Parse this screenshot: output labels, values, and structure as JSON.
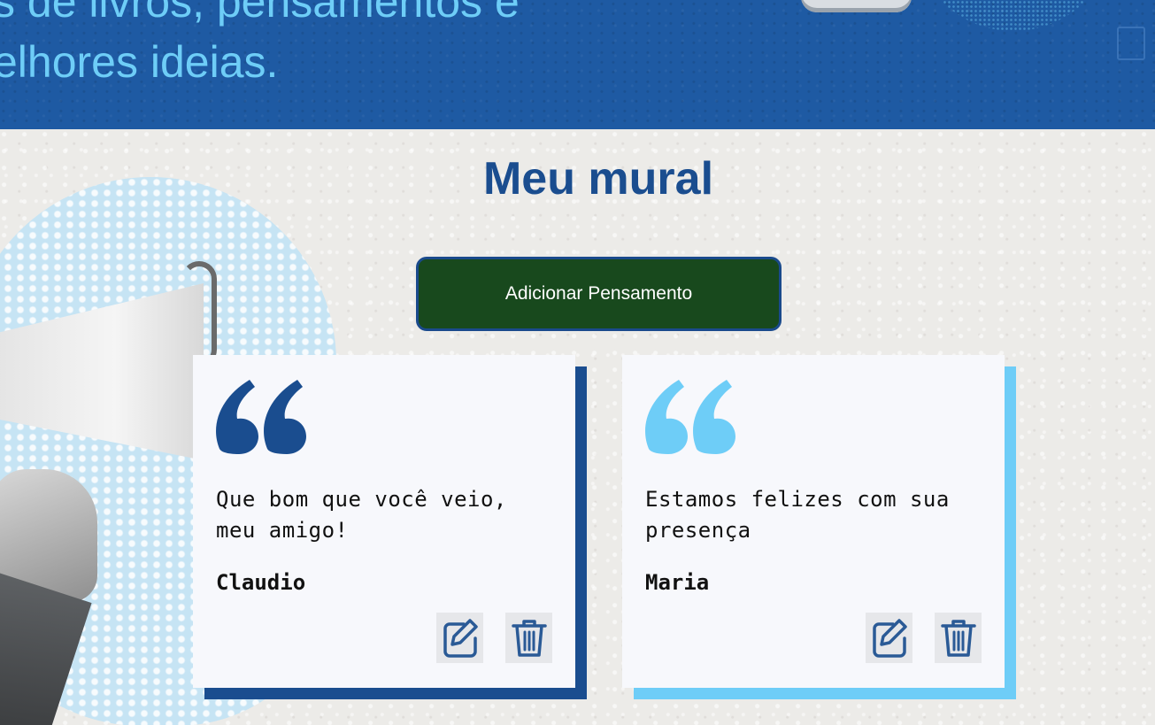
{
  "hero": {
    "line1": "s de livros, pensamentos e",
    "line2": "elhores ideias."
  },
  "section": {
    "title": "Meu mural"
  },
  "actions": {
    "add_label": "Adicionar Pensamento"
  },
  "cards": [
    {
      "text": "Que bom que você veio, meu amigo!",
      "author": "Claudio",
      "accent": "#1a4d8f"
    },
    {
      "text": "Estamos felizes com sua presença",
      "author": "Maria",
      "accent": "#6ecdf7"
    }
  ],
  "icons": {
    "edit": "edit-icon",
    "delete": "trash-icon",
    "quote": "quote-icon"
  },
  "colors": {
    "primary": "#1a4d8f",
    "accent_light": "#6ecdf7",
    "button_green": "#18491d",
    "icon_blue": "#2a5a96"
  }
}
